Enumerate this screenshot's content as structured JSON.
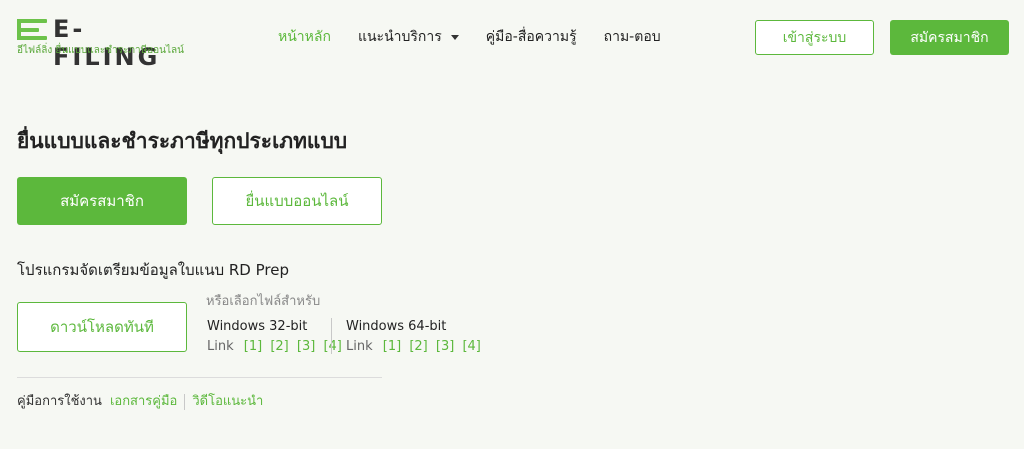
{
  "header": {
    "logo_text": "E-FILING",
    "logo_tagline": "อีไฟล์ลิ่ง ยื่นแบบและชำระภาษีออนไลน์",
    "nav": [
      {
        "label": "หน้าหลัก",
        "active": true
      },
      {
        "label": "แนะนำบริการ",
        "has_dropdown": true
      },
      {
        "label": "คู่มือ-สื่อความรู้"
      },
      {
        "label": "ถาม-ตอบ"
      }
    ],
    "login_label": "เข้าสู่ระบบ",
    "register_label": "สมัครสมาชิก"
  },
  "main": {
    "title": "ยื่นแบบและชำระภาษีทุกประเภทแบบ",
    "register_label": "สมัครสมาชิก",
    "file_online_label": "ยื่นแบบออนไลน์",
    "rdprep": {
      "title": "โปรแกรมจัดเตรียมข้อมูลใบแนบ RD Prep",
      "download_label": "ดาวน์โหลดทันที",
      "or_choose_label": "หรือเลือกไฟล์สำหรับ",
      "windows32": {
        "name": "Windows 32-bit",
        "link_label": "Link",
        "links": [
          "[1]",
          "[2]",
          "[3]",
          "[4]"
        ]
      },
      "windows64": {
        "name": "Windows 64-bit",
        "link_label": "Link",
        "links": [
          "[1]",
          "[2]",
          "[3]",
          "[4]"
        ]
      }
    },
    "guide": {
      "label": "คู่มือการใช้งาน",
      "doc_link": "เอกสารคู่มือ",
      "video_link": "วิดีโอแนะนำ"
    }
  },
  "colors": {
    "accent": "#5cb83c",
    "background": "#f6f8f3"
  }
}
